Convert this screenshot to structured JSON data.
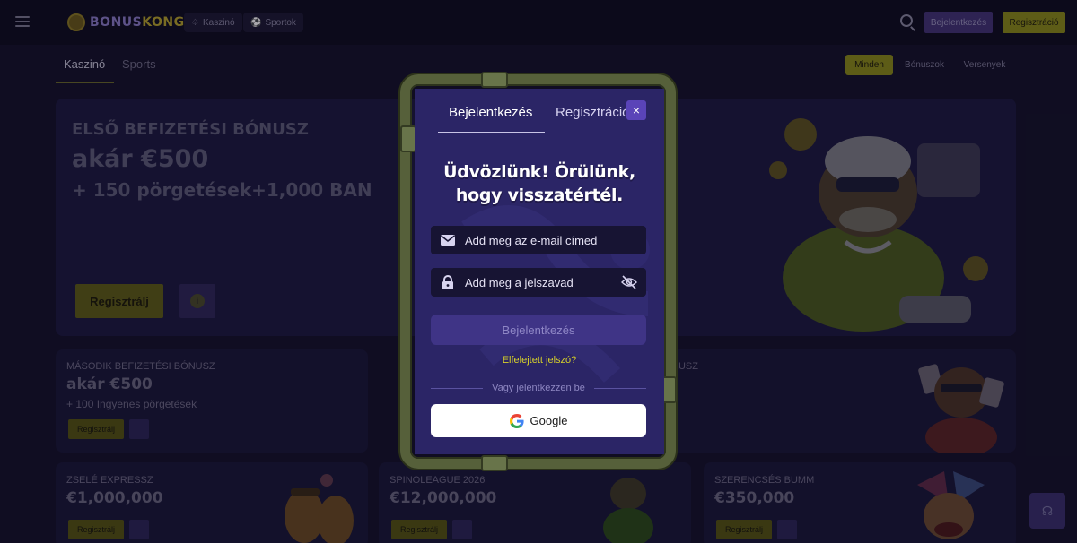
{
  "app": {
    "logo_text_a": "BONUS",
    "logo_text_b": "KONG"
  },
  "topbar": {
    "nav": [
      {
        "label": "Kaszinó",
        "icon": "spade-icon"
      },
      {
        "label": "Sportok",
        "icon": "ball-icon"
      }
    ],
    "login_label": "Bejelentkezés",
    "register_label": "Regisztráció"
  },
  "subnav": {
    "tabs": [
      "Kaszinó",
      "Sports"
    ],
    "active_tab": "Kaszinó",
    "filters": [
      "Minden",
      "Bónuszok",
      "Versenyek"
    ],
    "active_filter": "Minden"
  },
  "hero": {
    "line1": "ELSŐ BEFIZETÉSI BÓNUSZ",
    "line2": "akár €500",
    "line3": "+ 150 pörgetések+1,000 BAN",
    "cta": "Regisztrálj",
    "info": "i"
  },
  "cards": [
    {
      "label": "MÁSODIK BEFIZETÉSI BÓNUSZ",
      "big": "akár €500",
      "small": "+ 100 Ingyenes pörgetések",
      "cta": "Regisztrálj"
    },
    {
      "label": "NUSZ",
      "big": "",
      "small": "",
      "cta": ""
    },
    {
      "label": "ZSELÉ EXPRESSZ",
      "big": "€1,000,000",
      "small": "",
      "cta": "Regisztrálj"
    },
    {
      "label": "SPINOLEAGUE 2026",
      "big": "€12,000,000",
      "small": "",
      "cta": "Regisztrálj"
    },
    {
      "label": "SZERENCSÉS BUMM",
      "big": "€350,000",
      "small": "",
      "cta": "Regisztrálj"
    }
  ],
  "modal": {
    "tabs": [
      "Bejelentkezés",
      "Regisztráció"
    ],
    "active_tab": "Bejelentkezés",
    "close_label": "×",
    "welcome_line1": "Üdvözlünk! Örülünk,",
    "welcome_line2": "hogy visszatértél.",
    "email": {
      "placeholder": "Add meg az e-mail címed",
      "value": "",
      "icon": "envelope-icon"
    },
    "password": {
      "placeholder": "Add meg a jelszavad",
      "value": "",
      "icon": "lock-icon",
      "toggle_icon": "eye-off-icon"
    },
    "submit_label": "Bejelentkezés",
    "forgot_label": "Elfelejtett jelszó?",
    "divider_label": "Vagy jelentkezzen be",
    "google_label": "Google"
  },
  "colors": {
    "background": "#15122a",
    "modal": "#2b2566",
    "accent_yellow": "#d7d12a",
    "pipe": "#56603a",
    "button_disabled": "#3f3486"
  }
}
